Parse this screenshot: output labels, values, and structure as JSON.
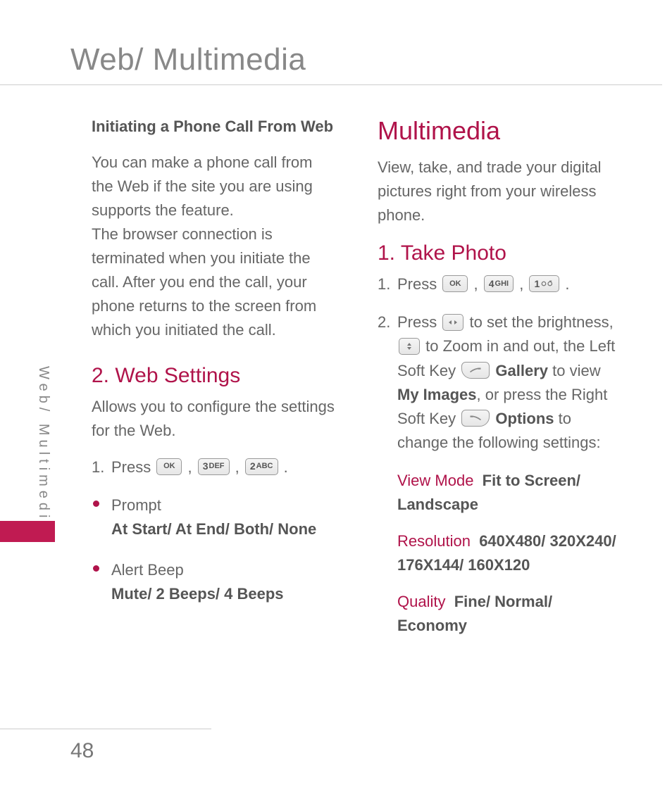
{
  "page": {
    "title": "Web/ Multimedia",
    "side_tab": "Web/ Multimedia",
    "number": "48"
  },
  "left": {
    "subhead": "Initiating a Phone Call From Web",
    "para": "You can make a phone call from the Web if the site you are using supports the feature.\nThe browser connection is terminated when you initiate the call. After you end the call, your phone returns to the screen from which you initiated the call.",
    "h2": "2. Web Settings",
    "intro": "Allows you to configure the settings for the Web.",
    "step1_a": "Press ",
    "comma": " , ",
    "period": " .",
    "key_ok": "OK",
    "key3_num": "3",
    "key3_let": "DEF",
    "key2_num": "2",
    "key2_let": "ABC",
    "bullet1_title": "Prompt",
    "bullet1_opts": "At Start/ At End/ Both/ None",
    "bullet2_title": "Alert Beep",
    "bullet2_opts": "Mute/ 2 Beeps/ 4 Beeps"
  },
  "right": {
    "h1": "Multimedia",
    "intro": "View, take, and trade your digital pictures right from your wireless phone.",
    "h2": "1. Take Photo",
    "step1_a": "Press ",
    "comma": " , ",
    "period": " .",
    "key_ok": "OK",
    "key4_num": "4",
    "key4_let": "GHI",
    "key1_num": "1",
    "step2_a": "Press ",
    "step2_b": " to set the brightness, ",
    "step2_c": " to Zoom in and out, the Left Soft Key ",
    "step2_gallery": "Gallery",
    "step2_d": " to view ",
    "step2_myimg": "My Images",
    "step2_e": ", or press the Right Soft Key ",
    "step2_options": "Options",
    "step2_f": " to change the following settings:",
    "s1_name": "View Mode",
    "s1_val": "Fit to Screen/ Landscape",
    "s2_name": "Resolution",
    "s2_val": "640X480/ 320X240/ 176X144/ 160X120",
    "s3_name": "Quality",
    "s3_val": "Fine/ Normal/ Economy",
    "softkey_dash": "—"
  }
}
